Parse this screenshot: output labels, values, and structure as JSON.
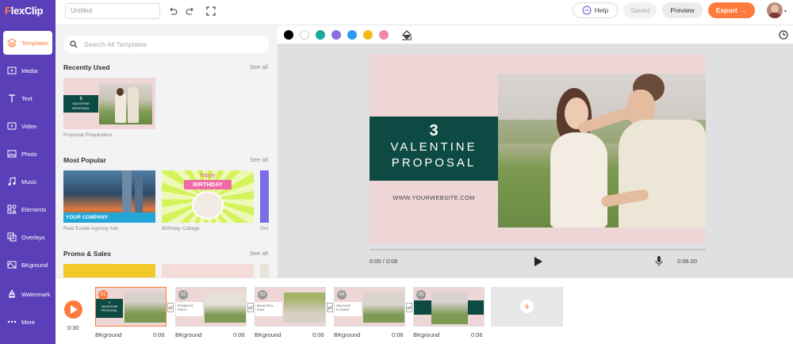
{
  "app": {
    "logo_prefix": "F",
    "logo_rest": "lexClip"
  },
  "sidebar": {
    "items": [
      {
        "label": "Templates",
        "icon": "layers-icon",
        "active": true
      },
      {
        "label": "Media",
        "icon": "media-icon"
      },
      {
        "label": "Text",
        "icon": "text-icon"
      },
      {
        "label": "Video",
        "icon": "video-icon"
      },
      {
        "label": "Photo",
        "icon": "photo-icon"
      },
      {
        "label": "Music",
        "icon": "music-icon"
      },
      {
        "label": "Elements",
        "icon": "elements-icon"
      },
      {
        "label": "Overlays",
        "icon": "overlays-icon"
      },
      {
        "label": "BKground",
        "icon": "background-icon"
      },
      {
        "label": "Watermark",
        "icon": "watermark-icon"
      },
      {
        "label": "More",
        "icon": "more-icon"
      }
    ]
  },
  "topbar": {
    "title_placeholder": "Untitled",
    "help": "Help",
    "saved": "Saved",
    "preview": "Preview",
    "export": "Export"
  },
  "templates": {
    "search_placeholder": "Search All Templates",
    "see_all": "See all",
    "recently_used": {
      "title": "Recently Used",
      "items": [
        "Proposal Preparation"
      ]
    },
    "most_popular": {
      "title": "Most Popular",
      "items": [
        "Real Estate Agency Ads",
        "Birthday Collage",
        "Onl"
      ]
    },
    "promo_sales": {
      "title": "Promo & Sales"
    },
    "thumb_texts": {
      "num": "3",
      "line1": "VALENTINE",
      "line2": "PROPOSAL",
      "company": "YOUR COMPANY",
      "happy": "happy",
      "birthday": "BIRTHDAY"
    }
  },
  "colors": {
    "swatches": [
      "#000000",
      "#ffffff",
      "#1aa99a",
      "#8a6fe0",
      "#2d9cf0",
      "#f5b91b",
      "#f08aa8"
    ],
    "accent": "#ff7a3d",
    "sidebar": "#5b3fb8",
    "teal": "#0e4a44"
  },
  "canvas": {
    "num": "3",
    "line1": "VALENTINE",
    "line2": "PROPOSAL",
    "website": "WWW.YOURWEBSITE.COM"
  },
  "player": {
    "time": "0:00 / 0:06",
    "duration": "0:06.00"
  },
  "timeline": {
    "total": "0:30",
    "clips": [
      {
        "num": "01",
        "label": "BKground",
        "dur": "0:06",
        "texts": [
          "3",
          "VALENTINE",
          "PROPOSAL"
        ]
      },
      {
        "num": "02",
        "label": "BKground",
        "dur": "0:06",
        "texts": [
          "ROMANTIC",
          "PIRCE"
        ]
      },
      {
        "num": "03",
        "label": "BKground",
        "dur": "0:06",
        "texts": [
          "BEAUTIFUL",
          "RING"
        ]
      },
      {
        "num": "04",
        "label": "BKground",
        "dur": "0:06",
        "texts": [
          "DELICATE",
          "FLOWER"
        ]
      },
      {
        "num": "05",
        "label": "BKground",
        "dur": "0:06",
        "texts": []
      }
    ],
    "add": "+"
  }
}
